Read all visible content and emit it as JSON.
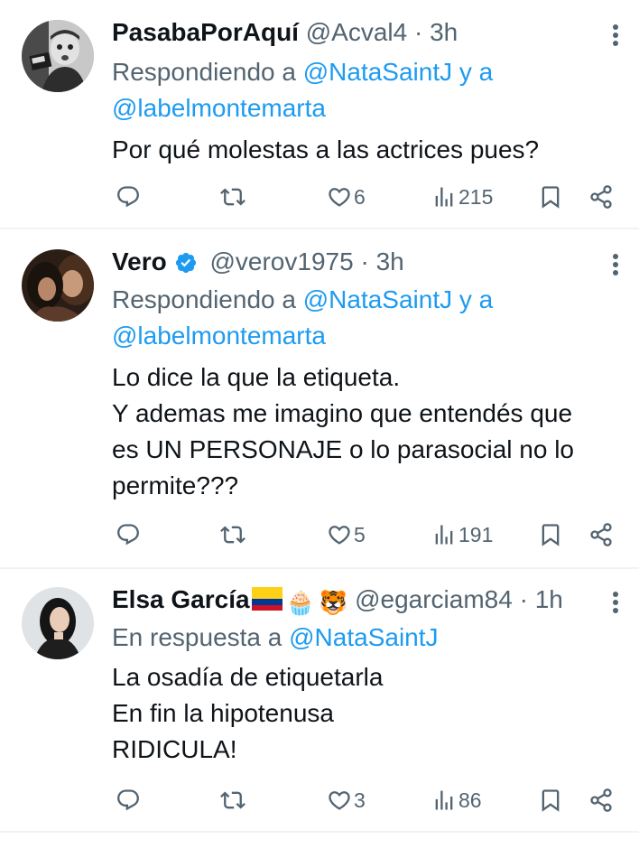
{
  "tweets": [
    {
      "name": "PasabaPorAquí",
      "handle": "@Acval4",
      "dot": "·",
      "time": "3h",
      "reply_prefix": "Respondiendo a ",
      "mention1": "@NataSaintJ",
      "reply_and": " y a",
      "mention2": "@labelmontemarta",
      "lines": [
        "Por qué molestas a las actrices pues?"
      ],
      "likes": "6",
      "views": "215"
    },
    {
      "name": "Vero",
      "handle": "@verov1975",
      "dot": "·",
      "time": "3h",
      "verified": true,
      "reply_prefix": "Respondiendo a ",
      "mention1": "@NataSaintJ",
      "reply_and": " y a",
      "mention2": "@labelmontemarta",
      "lines": [
        "Lo dice la que la etiqueta.",
        "Y ademas me imagino que entendés que",
        "es UN PERSONAJE o lo parasocial no lo",
        "permite???"
      ],
      "likes": "5",
      "views": "191"
    },
    {
      "name": "Elsa García",
      "handle": "@egarciam84",
      "dot": "·",
      "time": "1h",
      "emojis": [
        "🧁",
        "🐯"
      ],
      "reply_prefix": "En respuesta a ",
      "mention1": "@NataSaintJ",
      "lines": [
        "La osadía de etiquetarla",
        "En fin la hipotenusa",
        "RIDICULA!"
      ],
      "likes": "3",
      "views": "86"
    }
  ],
  "icons": {
    "reply": "speech-bubble-icon",
    "retweet": "retweet-arrows-icon",
    "like": "heart-icon",
    "views": "bar-chart-icon",
    "bookmark": "bookmark-icon",
    "share": "share-nodes-icon",
    "more": "vertical-ellipsis-icon",
    "verified": "verified-badge-icon"
  },
  "colors": {
    "text": "#0f1419",
    "secondary": "#536471",
    "mention": "#1d9bf0",
    "verified": "#1d9bf0",
    "divider": "#eff3f4"
  }
}
